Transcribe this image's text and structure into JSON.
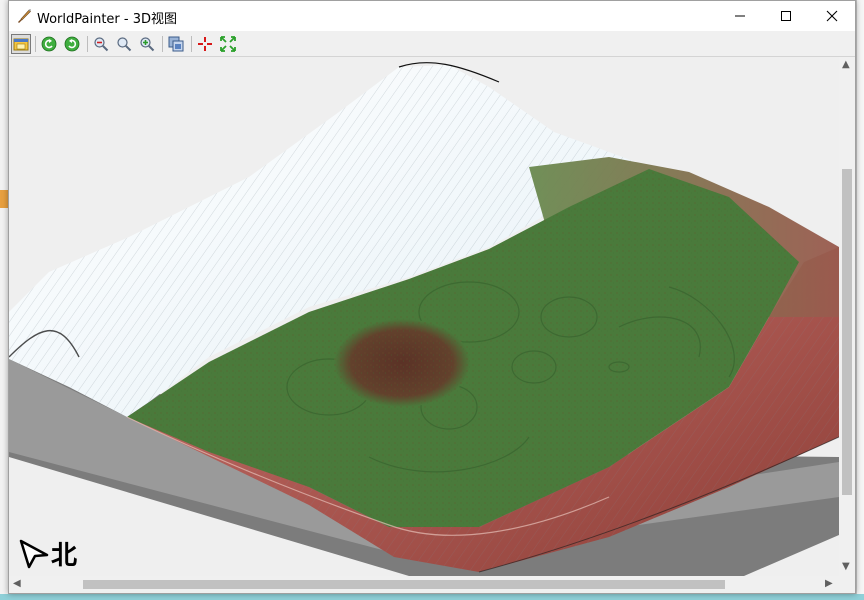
{
  "window": {
    "title": "WorldPainter - 3D视图",
    "controls": {
      "minimize": "minimize",
      "maximize": "maximize",
      "close": "close"
    }
  },
  "toolbar": {
    "buttons": [
      {
        "name": "always-on-top",
        "icon": "pin-window-icon",
        "pressed": true
      },
      {
        "name": "rotate-left",
        "icon": "rotate-left-icon"
      },
      {
        "name": "rotate-right",
        "icon": "rotate-right-icon"
      },
      {
        "name": "zoom-out",
        "icon": "zoom-out-icon"
      },
      {
        "name": "zoom-reset",
        "icon": "zoom-reset-icon"
      },
      {
        "name": "zoom-in",
        "icon": "zoom-in-icon"
      },
      {
        "name": "export-image",
        "icon": "export-image-icon"
      },
      {
        "name": "move-to-spawn",
        "icon": "spawn-crosshair-icon"
      },
      {
        "name": "fit-to-view",
        "icon": "fit-to-view-icon"
      }
    ]
  },
  "view": {
    "compass_label": "北",
    "colors": {
      "background": "#efefef",
      "snow": "#f4f8fb",
      "grass": "#4a7a3b",
      "dirt": "#5c3a2a",
      "mesa": "#a4544c",
      "base_top": "#9a9a9a",
      "base_side": "#7c7c7c"
    }
  }
}
